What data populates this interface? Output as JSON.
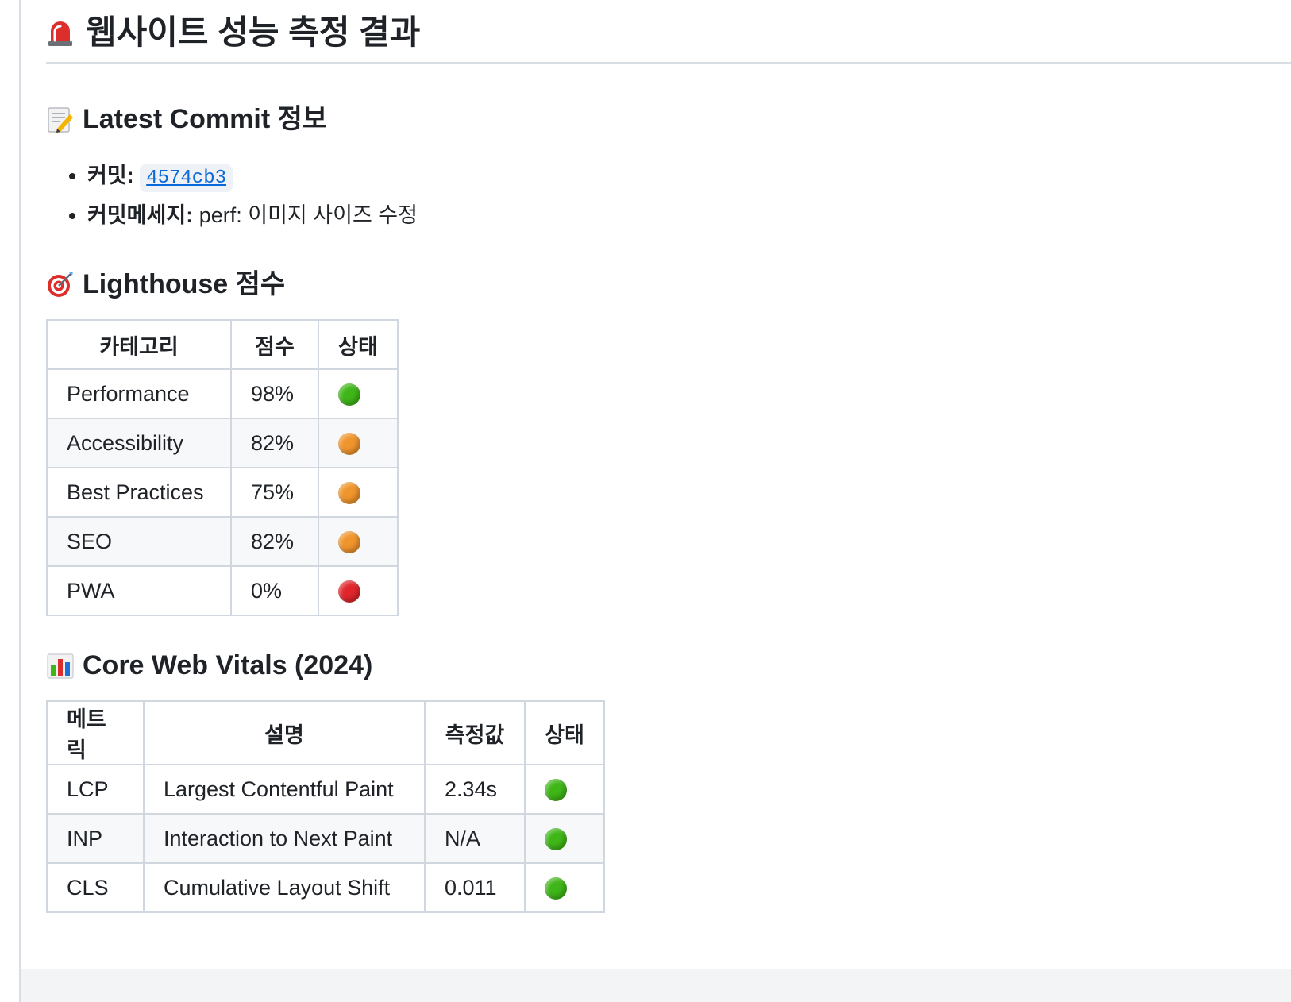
{
  "page": {
    "title": "웹사이트 성능 측정 결과",
    "title_icon": "rotating-light-icon"
  },
  "commit_section": {
    "heading": "Latest Commit 정보",
    "heading_icon": "memo-icon",
    "commit_label": "커밋:",
    "commit_hash": "4574cb3",
    "message_label": "커밋메세지:",
    "message_value": "perf: 이미지 사이즈 수정"
  },
  "lighthouse_section": {
    "heading": "Lighthouse 점수",
    "heading_icon": "direct-hit-icon",
    "headers": [
      "카테고리",
      "점수",
      "상태"
    ],
    "rows": [
      {
        "category": "Performance",
        "score": "98%",
        "status": "green",
        "status_color": "#3fb618"
      },
      {
        "category": "Accessibility",
        "score": "82%",
        "status": "orange",
        "status_color": "#f0952c"
      },
      {
        "category": "Best Practices",
        "score": "75%",
        "status": "orange",
        "status_color": "#f0952c"
      },
      {
        "category": "SEO",
        "score": "82%",
        "status": "orange",
        "status_color": "#f0952c"
      },
      {
        "category": "PWA",
        "score": "0%",
        "status": "red",
        "status_color": "#e0262b"
      }
    ]
  },
  "cwv_section": {
    "heading": "Core Web Vitals (2024)",
    "heading_icon": "bar-chart-icon",
    "headers": [
      "메트릭",
      "설명",
      "측정값",
      "상태"
    ],
    "rows": [
      {
        "metric": "LCP",
        "description": "Largest Contentful Paint",
        "value": "2.34s",
        "status": "green",
        "status_color": "#3fb618"
      },
      {
        "metric": "INP",
        "description": "Interaction to Next Paint",
        "value": "N/A",
        "status": "green",
        "status_color": "#3fb618"
      },
      {
        "metric": "CLS",
        "description": "Cumulative Layout Shift",
        "value": "0.011",
        "status": "green",
        "status_color": "#3fb618"
      }
    ]
  }
}
